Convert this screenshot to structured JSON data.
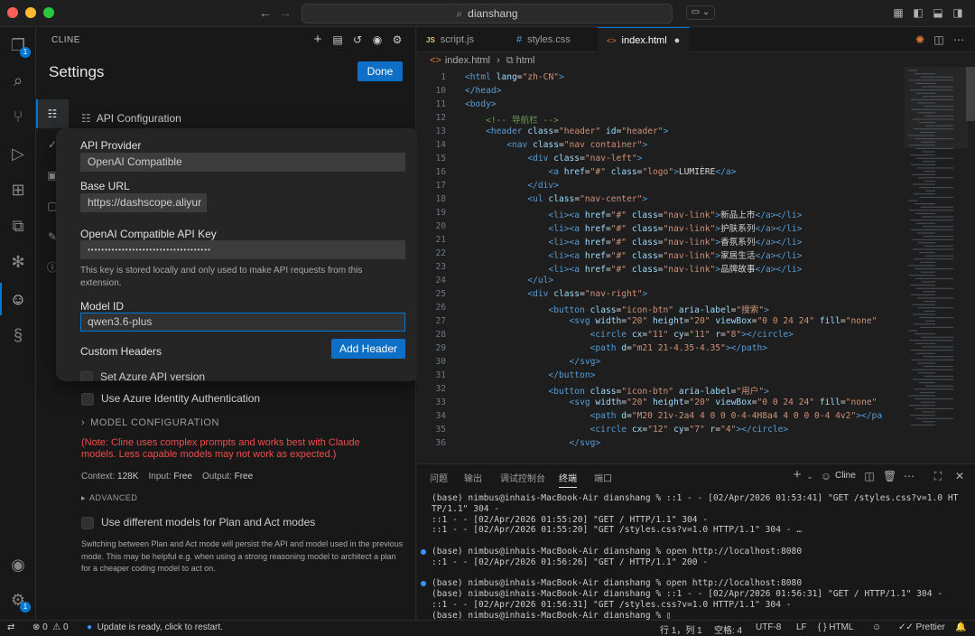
{
  "titlebar": {
    "search": "dianshang"
  },
  "activity": {
    "explorer_badge": "1",
    "accounts_badge": "1"
  },
  "panel": {
    "header": "CLINE",
    "title": "Settings",
    "done": "Done",
    "section_title": "API Configuration",
    "api_provider_label": "API Provider",
    "api_provider_value": "OpenAI Compatible",
    "base_url_label": "Base URL",
    "base_url_value": "https://dashscope.aliyur",
    "api_key_label": "OpenAI Compatible API Key",
    "api_key_value": "••••••••••••••••••••••••••••••••••••",
    "api_key_hint": "This key is stored locally and only used to make API requests from this extension.",
    "model_id_label": "Model ID",
    "model_id_value": "qwen3.6-plus",
    "custom_headers_label": "Custom Headers",
    "add_header": "Add Header",
    "set_azure": "Set Azure API version",
    "use_azure_identity": "Use Azure Identity Authentication",
    "model_configuration": "MODEL CONFIGURATION",
    "note": "(Note: Cline uses complex prompts and works best with Claude models. Less capable models may not work as expected.)",
    "context_label": "Context:",
    "context_value": "128K",
    "input_label": "Input:",
    "input_value": "Free",
    "output_label": "Output:",
    "output_value": "Free",
    "advanced": "ADVANCED",
    "plan_act_label": "Use different models for Plan and Act modes",
    "plan_act_desc": "Switching between Plan and Act mode will persist the API and model used in the previous mode. This may be helpful e.g. when using a strong reasoning model to architect a plan for a cheaper coding model to act on."
  },
  "editor": {
    "tabs": [
      {
        "icon": "JS",
        "label": "script.js"
      },
      {
        "icon": "#",
        "label": "styles.css"
      },
      {
        "icon": "<>",
        "label": "index.html"
      }
    ],
    "breadcrumb_file": "index.html",
    "breadcrumb_node": "html",
    "lines": [
      {
        "n": "1",
        "html": "<span class=\"tg\">&lt;html</span> <span class=\"at\">lang</span>=<span class=\"st2\">\"zh-CN\"</span><span class=\"tg\">&gt;</span>"
      },
      {
        "n": "10",
        "html": "<span class=\"tg\">&lt;/head&gt;</span>"
      },
      {
        "n": "11",
        "html": "<span class=\"tg\">&lt;body&gt;</span>"
      },
      {
        "n": "12",
        "html": "    <span class=\"cm\">&lt;!-- 导航栏 --&gt;</span>"
      },
      {
        "n": "13",
        "html": "    <span class=\"tg\">&lt;header</span> <span class=\"at\">class</span>=<span class=\"st2\">\"header\"</span> <span class=\"at\">id</span>=<span class=\"st2\">\"header\"</span><span class=\"tg\">&gt;</span>"
      },
      {
        "n": "14",
        "html": "        <span class=\"tg\">&lt;nav</span> <span class=\"at\">class</span>=<span class=\"st2\">\"nav container\"</span><span class=\"tg\">&gt;</span>"
      },
      {
        "n": "15",
        "html": "            <span class=\"tg\">&lt;div</span> <span class=\"at\">class</span>=<span class=\"st2\">\"nav-left\"</span><span class=\"tg\">&gt;</span>"
      },
      {
        "n": "16",
        "html": "                <span class=\"tg\">&lt;a</span> <span class=\"at\">href</span>=<span class=\"st2\">\"#\"</span> <span class=\"at\">class</span>=<span class=\"st2\">\"logo\"</span><span class=\"tg\">&gt;</span>LUMIÈRE<span class=\"tg\">&lt;/a&gt;</span>"
      },
      {
        "n": "17",
        "html": "            <span class=\"tg\">&lt;/div&gt;</span>"
      },
      {
        "n": "18",
        "html": "            <span class=\"tg\">&lt;ul</span> <span class=\"at\">class</span>=<span class=\"st2\">\"nav-center\"</span><span class=\"tg\">&gt;</span>"
      },
      {
        "n": "19",
        "html": "                <span class=\"tg\">&lt;li&gt;&lt;a</span> <span class=\"at\">href</span>=<span class=\"st2\">\"#\"</span> <span class=\"at\">class</span>=<span class=\"st2\">\"nav-link\"</span><span class=\"tg\">&gt;</span>新品上市<span class=\"tg\">&lt;/a&gt;&lt;/li&gt;</span>"
      },
      {
        "n": "20",
        "html": "                <span class=\"tg\">&lt;li&gt;&lt;a</span> <span class=\"at\">href</span>=<span class=\"st2\">\"#\"</span> <span class=\"at\">class</span>=<span class=\"st2\">\"nav-link\"</span><span class=\"tg\">&gt;</span>护肤系列<span class=\"tg\">&lt;/a&gt;&lt;/li&gt;</span>"
      },
      {
        "n": "21",
        "html": "                <span class=\"tg\">&lt;li&gt;&lt;a</span> <span class=\"at\">href</span>=<span class=\"st2\">\"#\"</span> <span class=\"at\">class</span>=<span class=\"st2\">\"nav-link\"</span><span class=\"tg\">&gt;</span>香氛系列<span class=\"tg\">&lt;/a&gt;&lt;/li&gt;</span>"
      },
      {
        "n": "22",
        "html": "                <span class=\"tg\">&lt;li&gt;&lt;a</span> <span class=\"at\">href</span>=<span class=\"st2\">\"#\"</span> <span class=\"at\">class</span>=<span class=\"st2\">\"nav-link\"</span><span class=\"tg\">&gt;</span>家居生活<span class=\"tg\">&lt;/a&gt;&lt;/li&gt;</span>"
      },
      {
        "n": "23",
        "html": "                <span class=\"tg\">&lt;li&gt;&lt;a</span> <span class=\"at\">href</span>=<span class=\"st2\">\"#\"</span> <span class=\"at\">class</span>=<span class=\"st2\">\"nav-link\"</span><span class=\"tg\">&gt;</span>品牌故事<span class=\"tg\">&lt;/a&gt;&lt;/li&gt;</span>"
      },
      {
        "n": "24",
        "html": "            <span class=\"tg\">&lt;/ul&gt;</span>"
      },
      {
        "n": "25",
        "html": "            <span class=\"tg\">&lt;div</span> <span class=\"at\">class</span>=<span class=\"st2\">\"nav-right\"</span><span class=\"tg\">&gt;</span>"
      },
      {
        "n": "26",
        "html": "                <span class=\"tg\">&lt;button</span> <span class=\"at\">class</span>=<span class=\"st2\">\"icon-btn\"</span> <span class=\"at\">aria-label</span>=<span class=\"st2\">\"搜索\"</span><span class=\"tg\">&gt;</span>"
      },
      {
        "n": "27",
        "html": "                    <span class=\"tg\">&lt;svg</span> <span class=\"at\">width</span>=<span class=\"st2\">\"20\"</span> <span class=\"at\">height</span>=<span class=\"st2\">\"20\"</span> <span class=\"at\">viewBox</span>=<span class=\"st2\">\"0 0 24 24\"</span> <span class=\"at\">fill</span>=<span class=\"st2\">\"none\"</span>"
      },
      {
        "n": "28",
        "html": "                        <span class=\"tg\">&lt;circle</span> <span class=\"at\">cx</span>=<span class=\"st2\">\"11\"</span> <span class=\"at\">cy</span>=<span class=\"st2\">\"11\"</span> <span class=\"at\">r</span>=<span class=\"st2\">\"8\"</span><span class=\"tg\">&gt;&lt;/circle&gt;</span>"
      },
      {
        "n": "29",
        "html": "                        <span class=\"tg\">&lt;path</span> <span class=\"at\">d</span>=<span class=\"st2\">\"m21 21-4.35-4.35\"</span><span class=\"tg\">&gt;&lt;/path&gt;</span>"
      },
      {
        "n": "30",
        "html": "                    <span class=\"tg\">&lt;/svg&gt;</span>"
      },
      {
        "n": "31",
        "html": "                <span class=\"tg\">&lt;/button&gt;</span>"
      },
      {
        "n": "32",
        "html": "                <span class=\"tg\">&lt;button</span> <span class=\"at\">class</span>=<span class=\"st2\">\"icon-btn\"</span> <span class=\"at\">aria-label</span>=<span class=\"st2\">\"用户\"</span><span class=\"tg\">&gt;</span>"
      },
      {
        "n": "33",
        "html": "                    <span class=\"tg\">&lt;svg</span> <span class=\"at\">width</span>=<span class=\"st2\">\"20\"</span> <span class=\"at\">height</span>=<span class=\"st2\">\"20\"</span> <span class=\"at\">viewBox</span>=<span class=\"st2\">\"0 0 24 24\"</span> <span class=\"at\">fill</span>=<span class=\"st2\">\"none\"</span>"
      },
      {
        "n": "34",
        "html": "                        <span class=\"tg\">&lt;path</span> <span class=\"at\">d</span>=<span class=\"st2\">\"M20 21v-2a4 4 0 0 0-4-4H8a4 4 0 0 0-4 4v2\"</span><span class=\"tg\">&gt;&lt;/pa</span>"
      },
      {
        "n": "35",
        "html": "                        <span class=\"tg\">&lt;circle</span> <span class=\"at\">cx</span>=<span class=\"st2\">\"12\"</span> <span class=\"at\">cy</span>=<span class=\"st2\">\"7\"</span> <span class=\"at\">r</span>=<span class=\"st2\">\"4\"</span><span class=\"tg\">&gt;&lt;/circle&gt;</span>"
      },
      {
        "n": "36",
        "html": "                    <span class=\"tg\">&lt;/svg&gt;</span>"
      }
    ]
  },
  "terminal": {
    "tabs": [
      "问题",
      "输出",
      "调试控制台",
      "终端",
      "端口"
    ],
    "active_tab": "终端",
    "cline_label": "Cline",
    "lines": [
      {
        "text": "(base) nimbus@inhais-MacBook-Air dianshang % ::1 - - [02/Apr/2026 01:53:41] \"GET /styles.css?v=1.0 HT",
        "dot": false
      },
      {
        "text": "TP/1.1\" 304 -",
        "dot": false
      },
      {
        "text": "::1 - - [02/Apr/2026 01:55:20] \"GET / HTTP/1.1\" 304 -",
        "dot": false
      },
      {
        "text": "::1 - - [02/Apr/2026 01:55:20] \"GET /styles.css?v=1.0 HTTP/1.1\" 304 - …",
        "dot": false
      },
      {
        "text": "",
        "dot": false
      },
      {
        "text": "(base) nimbus@inhais-MacBook-Air dianshang % open http://localhost:8080",
        "dot": true
      },
      {
        "text": "::1 - - [02/Apr/2026 01:56:26] \"GET / HTTP/1.1\" 200 -",
        "dot": false
      },
      {
        "text": "",
        "dot": false
      },
      {
        "text": "(base) nimbus@inhais-MacBook-Air dianshang % open http://localhost:8080",
        "dot": true
      },
      {
        "text": "(base) nimbus@inhais-MacBook-Air dianshang % ::1 - - [02/Apr/2026 01:56:31] \"GET / HTTP/1.1\" 304 -",
        "dot": false
      },
      {
        "text": "::1 - - [02/Apr/2026 01:56:31] \"GET /styles.css?v=1.0 HTTP/1.1\" 304 -",
        "dot": false
      },
      {
        "text": "(base) nimbus@inhais-MacBook-Air dianshang % ▯",
        "dot": false
      }
    ]
  },
  "status": {
    "errors": "0",
    "warnings": "0",
    "update_msg": "Update is ready, click to restart.",
    "position": "行 1，列 1",
    "spaces": "空格: 4",
    "encoding": "UTF-8",
    "eol": "LF",
    "language": "HTML",
    "prettier": "Prettier"
  }
}
